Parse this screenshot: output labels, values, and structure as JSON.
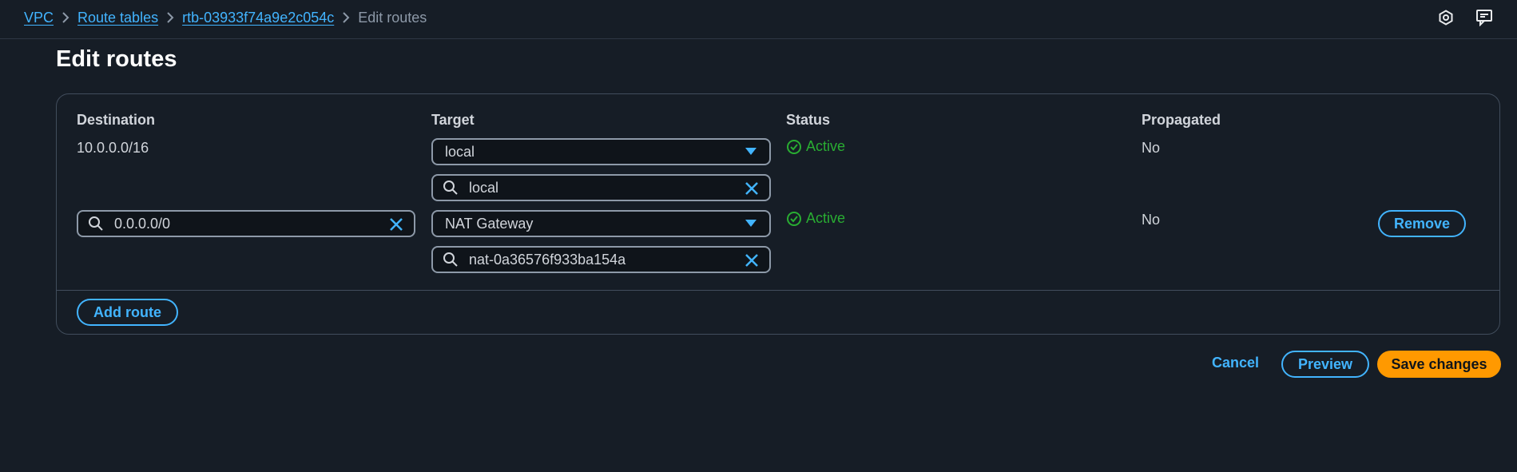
{
  "breadcrumb": {
    "items": [
      "VPC",
      "Route tables",
      "rtb-03933f74a9e2c054c"
    ],
    "current": "Edit routes"
  },
  "header_icons": [
    "settings-hex-icon",
    "feedback-icon"
  ],
  "page": {
    "title": "Edit routes"
  },
  "table": {
    "columns": [
      "Destination",
      "Target",
      "Status",
      "Propagated"
    ],
    "rows": [
      {
        "destination": "10.0.0.0/16",
        "target_type": "local",
        "target_search": "local",
        "status": "Active",
        "propagated": "No"
      },
      {
        "destination_input": "0.0.0.0/0",
        "target_type": "NAT Gateway",
        "target_search": "nat-0a36576f933ba154a",
        "status": "Active",
        "propagated": "No",
        "remove_label": "Remove"
      }
    ]
  },
  "add_route_label": "Add route",
  "footer": {
    "cancel": "Cancel",
    "preview": "Preview",
    "save": "Save changes"
  },
  "colors": {
    "background": "#161d26",
    "link": "#42b4ff",
    "primary": "#ff9900",
    "success": "#29ad32"
  }
}
